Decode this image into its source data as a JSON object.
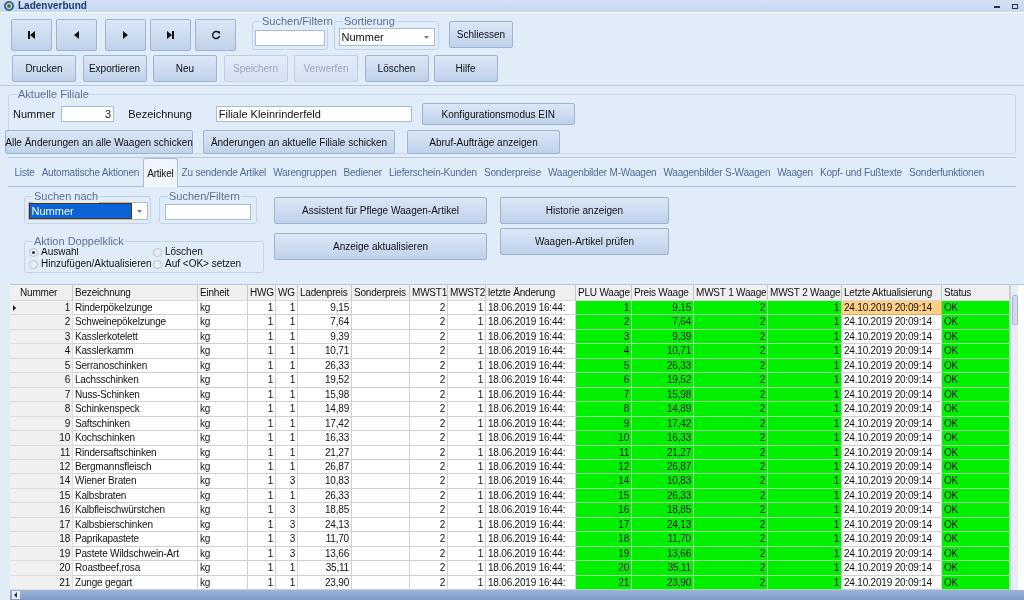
{
  "window": {
    "title": "Ladenverbund"
  },
  "toolbar": {
    "nav_buttons": [
      {
        "kind": "first"
      },
      {
        "kind": "prev"
      },
      {
        "kind": "next"
      },
      {
        "kind": "last"
      },
      {
        "kind": "refresh"
      }
    ],
    "search": {
      "label": "Suchen/Filtern"
    },
    "sort": {
      "label": "Sortierung",
      "value": "Nummer"
    },
    "close_button": {
      "label": "Schliessen",
      "disabled": false
    },
    "buttons": [
      {
        "label": "Drucken",
        "disabled": false
      },
      {
        "label": "Exportieren",
        "disabled": false
      },
      {
        "label": "Neu",
        "disabled": false
      },
      {
        "label": "Speichern",
        "disabled": true
      },
      {
        "label": "Verwerfen",
        "disabled": true
      },
      {
        "label": "Löschen",
        "disabled": false
      },
      {
        "label": "Hilfe",
        "disabled": false
      }
    ]
  },
  "branch": {
    "title": "Aktuelle Filiale",
    "number_label": "Nummer",
    "number": "3",
    "name_label": "Bezeichnung",
    "name": "Filiale Kleinrinderfeld",
    "send_all_button": "Alle Änderungen an alle Waagen schicken",
    "send_branch_button": "Änderungen an aktuelle Filiale schicken",
    "config_button": "Konfigurationsmodus EIN",
    "jobs_button": "Abruf-Aufträge anzeigen"
  },
  "tabs": [
    {
      "label": "Liste",
      "selected": false
    },
    {
      "label": "Automatische Aktionen",
      "selected": false
    },
    {
      "label": "Artikel",
      "selected": true
    },
    {
      "label": "Zu sendende Artikel",
      "selected": false
    },
    {
      "label": "Warengruppen",
      "selected": false
    },
    {
      "label": "Bediener",
      "selected": false
    },
    {
      "label": "Lieferschein-Kunden",
      "selected": false
    },
    {
      "label": "Sonderpreise",
      "selected": false
    },
    {
      "label": "Waagenbilder M-Waagen",
      "selected": false
    },
    {
      "label": "Waagenbilder S-Waagen",
      "selected": false
    },
    {
      "label": "Waagen",
      "selected": false
    },
    {
      "label": "Kopf- und Fußtexte",
      "selected": false
    },
    {
      "label": "Sonderfunktionen",
      "selected": false
    }
  ],
  "article_panel": {
    "search_by": {
      "label": "Suchen nach",
      "value": "Nummer"
    },
    "filter": {
      "label": "Suchen/Filtern"
    },
    "wizard_button": "Assistent für Pflege Waagen-Artikel",
    "refresh_button": "Anzeige aktualisieren",
    "history_button": "Historie anzeigen",
    "check_button": "Waagen-Artikel prüfen",
    "double_click": {
      "label": "Aktion Doppelklick",
      "options": [
        {
          "label": "Auswahl",
          "selected": true
        },
        {
          "label": "Löschen",
          "selected": false
        },
        {
          "label": "Hinzufügen/Aktualisieren",
          "selected": false
        },
        {
          "label": "Auf <OK> setzen",
          "selected": false
        }
      ]
    }
  },
  "table": {
    "columns": [
      {
        "label": "Nummer",
        "kind": "number"
      },
      {
        "label": "Bezeichnung",
        "kind": "text"
      },
      {
        "label": "Einheit",
        "kind": "text"
      },
      {
        "label": "HWG",
        "kind": "number"
      },
      {
        "label": "WG",
        "kind": "number"
      },
      {
        "label": "Ladenpreis",
        "kind": "number"
      },
      {
        "label": "Sonderpreis",
        "kind": "number"
      },
      {
        "label": "MWST1",
        "kind": "number"
      },
      {
        "label": "MWST2",
        "kind": "number"
      },
      {
        "label": "letzte Änderung",
        "kind": "text"
      },
      {
        "label": "PLU Waage",
        "kind": "scale"
      },
      {
        "label": "Preis Waage",
        "kind": "scale"
      },
      {
        "label": "MWST 1 Waage",
        "kind": "scale"
      },
      {
        "label": "MWST 2 Waage",
        "kind": "scale"
      },
      {
        "label": "Letzte Aktualisierung",
        "kind": "date"
      },
      {
        "label": "Status",
        "kind": "status"
      }
    ],
    "rows": [
      {
        "selected": true,
        "cells": [
          "1",
          "Rinderpökelzunge",
          "kg",
          "1",
          "1",
          "9,15",
          "",
          "2",
          "1",
          "18.06.2019 16:44:",
          "1",
          "9,15",
          "2",
          "1",
          "24.10.2019 20:09:14",
          "OK"
        ]
      },
      {
        "selected": false,
        "cells": [
          "2",
          "Schweinepökelzunge",
          "kg",
          "1",
          "1",
          "7,64",
          "",
          "2",
          "1",
          "18.06.2019 16:44:",
          "2",
          "7,64",
          "2",
          "1",
          "24.10.2019 20:09:14",
          "OK"
        ]
      },
      {
        "selected": false,
        "cells": [
          "3",
          "Kasslerkotelett",
          "kg",
          "1",
          "1",
          "9,39",
          "",
          "2",
          "1",
          "18.06.2019 16:44:",
          "3",
          "9,39",
          "2",
          "1",
          "24.10.2019 20:09:14",
          "OK"
        ]
      },
      {
        "selected": false,
        "cells": [
          "4",
          "Kasslerkamm",
          "kg",
          "1",
          "1",
          "10,71",
          "",
          "2",
          "1",
          "18.06.2019 16:44:",
          "4",
          "10,71",
          "2",
          "1",
          "24.10.2019 20:09:14",
          "OK"
        ]
      },
      {
        "selected": false,
        "cells": [
          "5",
          "Serranoschinken",
          "kg",
          "1",
          "1",
          "26,33",
          "",
          "2",
          "1",
          "18.06.2019 16:44:",
          "5",
          "26,33",
          "2",
          "1",
          "24.10.2019 20:09:14",
          "OK"
        ]
      },
      {
        "selected": false,
        "cells": [
          "6",
          "Lachsschinken",
          "kg",
          "1",
          "1",
          "19,52",
          "",
          "2",
          "1",
          "18.06.2019 16:44:",
          "6",
          "19,52",
          "2",
          "1",
          "24.10.2019 20:09:14",
          "OK"
        ]
      },
      {
        "selected": false,
        "cells": [
          "7",
          "Nuss-Schinken",
          "kg",
          "1",
          "1",
          "15,98",
          "",
          "2",
          "1",
          "18.06.2019 16:44:",
          "7",
          "15,98",
          "2",
          "1",
          "24.10.2019 20:09:14",
          "OK"
        ]
      },
      {
        "selected": false,
        "cells": [
          "8",
          "Schinkenspeck",
          "kg",
          "1",
          "1",
          "14,89",
          "",
          "2",
          "1",
          "18.06.2019 16:44:",
          "8",
          "14,89",
          "2",
          "1",
          "24.10.2019 20:09:14",
          "OK"
        ]
      },
      {
        "selected": false,
        "cells": [
          "9",
          "Saftschinken",
          "kg",
          "1",
          "1",
          "17,42",
          "",
          "2",
          "1",
          "18.06.2019 16:44:",
          "9",
          "17,42",
          "2",
          "1",
          "24.10.2019 20:09:14",
          "OK"
        ]
      },
      {
        "selected": false,
        "cells": [
          "10",
          "Kochschinken",
          "kg",
          "1",
          "1",
          "16,33",
          "",
          "2",
          "1",
          "18.06.2019 16:44:",
          "10",
          "16,33",
          "2",
          "1",
          "24.10.2019 20:09:14",
          "OK"
        ]
      },
      {
        "selected": false,
        "cells": [
          "11",
          "Rindersaftschinken",
          "kg",
          "1",
          "1",
          "21,27",
          "",
          "2",
          "1",
          "18.06.2019 16:44:",
          "11",
          "21,27",
          "2",
          "1",
          "24.10.2019 20:09:14",
          "OK"
        ]
      },
      {
        "selected": false,
        "cells": [
          "12",
          "Bergmannsfleisch",
          "kg",
          "1",
          "1",
          "26,87",
          "",
          "2",
          "1",
          "18.06.2019 16:44:",
          "12",
          "26,87",
          "2",
          "1",
          "24.10.2019 20:09:14",
          "OK"
        ]
      },
      {
        "selected": false,
        "cells": [
          "14",
          "Wiener Braten",
          "kg",
          "1",
          "3",
          "10,83",
          "",
          "2",
          "1",
          "18.06.2019 16:44:",
          "14",
          "10,83",
          "2",
          "1",
          "24.10.2019 20:09:14",
          "OK"
        ]
      },
      {
        "selected": false,
        "cells": [
          "15",
          "Kalbsbraten",
          "kg",
          "1",
          "1",
          "26,33",
          "",
          "2",
          "1",
          "18.06.2019 16:44:",
          "15",
          "26,33",
          "2",
          "1",
          "24.10.2019 20:09:14",
          "OK"
        ]
      },
      {
        "selected": false,
        "cells": [
          "16",
          "Kalbfleischwürstchen",
          "kg",
          "1",
          "3",
          "18,85",
          "",
          "2",
          "1",
          "18.06.2019 16:44:",
          "16",
          "18,85",
          "2",
          "1",
          "24.10.2019 20:09:14",
          "OK"
        ]
      },
      {
        "selected": false,
        "cells": [
          "17",
          "Kalbsbierschinken",
          "kg",
          "1",
          "3",
          "24,13",
          "",
          "2",
          "1",
          "18.06.2019 16:44:",
          "17",
          "24,13",
          "2",
          "1",
          "24.10.2019 20:09:14",
          "OK"
        ]
      },
      {
        "selected": false,
        "cells": [
          "18",
          "Paprikapastete",
          "kg",
          "1",
          "3",
          "11,70",
          "",
          "2",
          "1",
          "18.06.2019 16:44:",
          "18",
          "11,70",
          "2",
          "1",
          "24.10.2019 20:09:14",
          "OK"
        ]
      },
      {
        "selected": false,
        "cells": [
          "19",
          "Pastete Wildschwein-Art",
          "kg",
          "1",
          "3",
          "13,66",
          "",
          "2",
          "1",
          "18.06.2019 16:44:",
          "19",
          "13,66",
          "2",
          "1",
          "24.10.2019 20:09:14",
          "OK"
        ]
      },
      {
        "selected": false,
        "cells": [
          "20",
          "Roastbeef,rosa",
          "kg",
          "1",
          "1",
          "35,11",
          "",
          "2",
          "1",
          "18.06.2019 16:44:",
          "20",
          "35,11",
          "2",
          "1",
          "24.10.2019 20:09:14",
          "OK"
        ]
      },
      {
        "selected": false,
        "cells": [
          "21",
          "Zunge gegart",
          "kg",
          "1",
          "1",
          "23,90",
          "",
          "2",
          "1",
          "18.06.2019 16:44:",
          "21",
          "23,90",
          "2",
          "1",
          "24.10.2019 20:09:14",
          "OK"
        ]
      }
    ]
  }
}
